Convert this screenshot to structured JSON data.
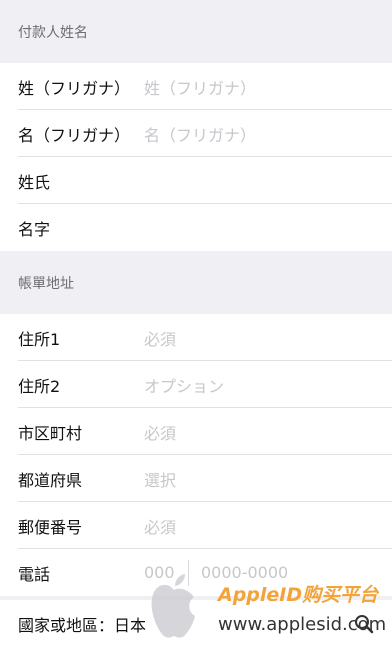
{
  "payer_section": {
    "header": "付款人姓名",
    "rows": [
      {
        "label": "姓（フリガナ）",
        "placeholder": "姓（フリガナ）"
      },
      {
        "label": "名（フリガナ）",
        "placeholder": "名（フリガナ）"
      },
      {
        "label": "姓氏",
        "value": ""
      },
      {
        "label": "名字",
        "value": ""
      }
    ]
  },
  "billing_section": {
    "header": "帳單地址",
    "rows": [
      {
        "label": "住所1",
        "placeholder": "必須"
      },
      {
        "label": "住所2",
        "placeholder": "オプション"
      },
      {
        "label": "市区町村",
        "placeholder": "必須"
      },
      {
        "label": "都道府県",
        "placeholder": "選択"
      },
      {
        "label": "郵便番号",
        "placeholder": "必須"
      }
    ],
    "phone": {
      "label": "電話",
      "area_placeholder": "000",
      "number_placeholder": "0000-0000"
    }
  },
  "country": {
    "label": "國家或地區：日本"
  },
  "watermark": {
    "title": "AppleID购买平台",
    "url": "www.applesid.com"
  },
  "colors": {
    "background": "#efeff4",
    "placeholder": "#c7c7cc",
    "watermark_accent": "#f2a43a"
  }
}
